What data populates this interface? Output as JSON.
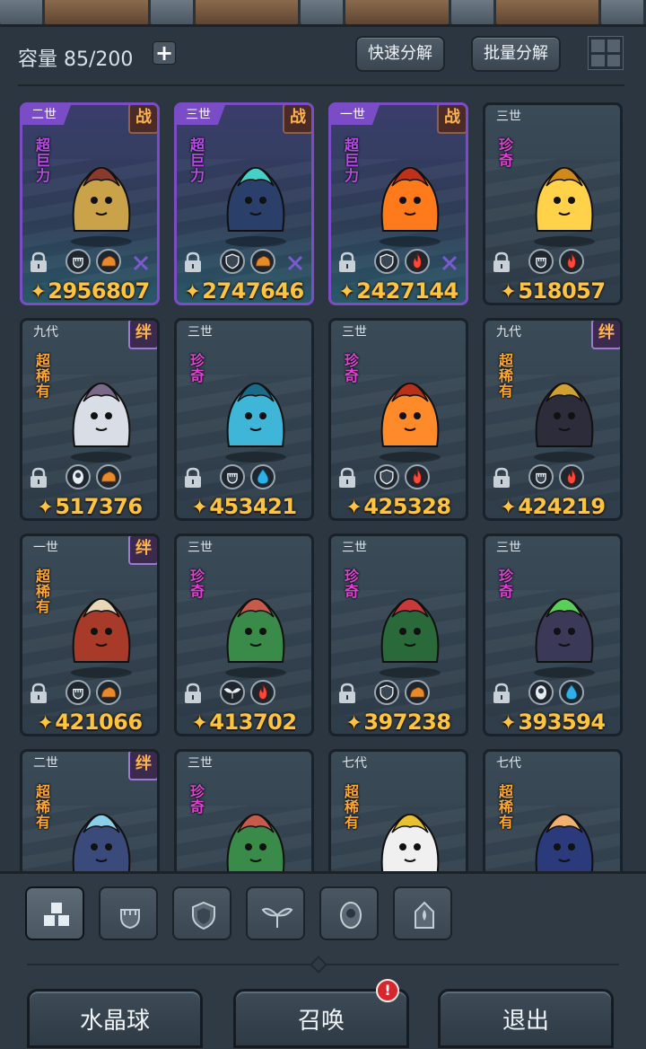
{
  "header": {
    "capacity": "容量 85/200",
    "plus_label": "+",
    "quick_decompose": "快速分解",
    "batch_decompose": "批量分解"
  },
  "cards": [
    {
      "gen": "二世",
      "badge": "战",
      "rarity": "超巨力",
      "power": "2956807",
      "icons": [
        "fist-icon",
        "rock-icon"
      ],
      "style": "purple"
    },
    {
      "gen": "三世",
      "badge": "战",
      "rarity": "超巨力",
      "power": "2747646",
      "icons": [
        "shield-icon",
        "rock-icon"
      ],
      "style": "purple"
    },
    {
      "gen": "一世",
      "badge": "战",
      "rarity": "超巨力",
      "power": "2427144",
      "icons": [
        "shield-icon",
        "fire-icon"
      ],
      "style": "purple"
    },
    {
      "gen": "三世",
      "badge": "",
      "rarity": "珍奇",
      "power": "518057",
      "icons": [
        "fist-icon",
        "fire-icon"
      ],
      "style": "normal"
    },
    {
      "gen": "九代",
      "badge": "绊",
      "rarity": "超稀有",
      "power": "517376",
      "icons": [
        "eye-icon",
        "rock-icon"
      ],
      "style": "normal"
    },
    {
      "gen": "三世",
      "badge": "",
      "rarity": "珍奇",
      "power": "453421",
      "icons": [
        "fist-icon",
        "water-icon"
      ],
      "style": "normal"
    },
    {
      "gen": "三世",
      "badge": "",
      "rarity": "珍奇",
      "power": "425328",
      "icons": [
        "shield-icon",
        "fire-icon"
      ],
      "style": "normal"
    },
    {
      "gen": "九代",
      "badge": "绊",
      "rarity": "超稀有",
      "power": "424219",
      "icons": [
        "fist-icon",
        "fire-icon"
      ],
      "style": "normal"
    },
    {
      "gen": "一世",
      "badge": "绊",
      "rarity": "超稀有",
      "power": "421066",
      "icons": [
        "fist-icon",
        "rock-icon"
      ],
      "style": "normal"
    },
    {
      "gen": "三世",
      "badge": "",
      "rarity": "珍奇",
      "power": "413702",
      "icons": [
        "leaf-icon",
        "fire-icon"
      ],
      "style": "normal"
    },
    {
      "gen": "三世",
      "badge": "",
      "rarity": "珍奇",
      "power": "397238",
      "icons": [
        "shield-icon",
        "rock-icon"
      ],
      "style": "normal"
    },
    {
      "gen": "三世",
      "badge": "",
      "rarity": "珍奇",
      "power": "393594",
      "icons": [
        "eye-icon",
        "water-icon"
      ],
      "style": "normal"
    },
    {
      "gen": "二世",
      "badge": "绊",
      "rarity": "超稀有",
      "power": "",
      "icons": [],
      "style": "normal"
    },
    {
      "gen": "三世",
      "badge": "",
      "rarity": "珍奇",
      "power": "",
      "icons": [],
      "style": "normal"
    },
    {
      "gen": "七代",
      "badge": "",
      "rarity": "超稀有",
      "power": "",
      "icons": [],
      "style": "normal"
    },
    {
      "gen": "七代",
      "badge": "",
      "rarity": "超稀有",
      "power": "",
      "icons": [],
      "style": "normal"
    }
  ],
  "filters": [
    "all-icon",
    "fist-icon",
    "shield-icon",
    "leaf-icon",
    "eye-icon",
    "tower-icon"
  ],
  "buttons": {
    "crystal": "水晶球",
    "summon": "召唤",
    "exit": "退出",
    "summon_alert": "!"
  },
  "colors": {
    "power": "#ffc43d",
    "purple_frame": "#7a4dc7",
    "legend_text": "#ffa733",
    "rare_text": "#e042d6"
  }
}
